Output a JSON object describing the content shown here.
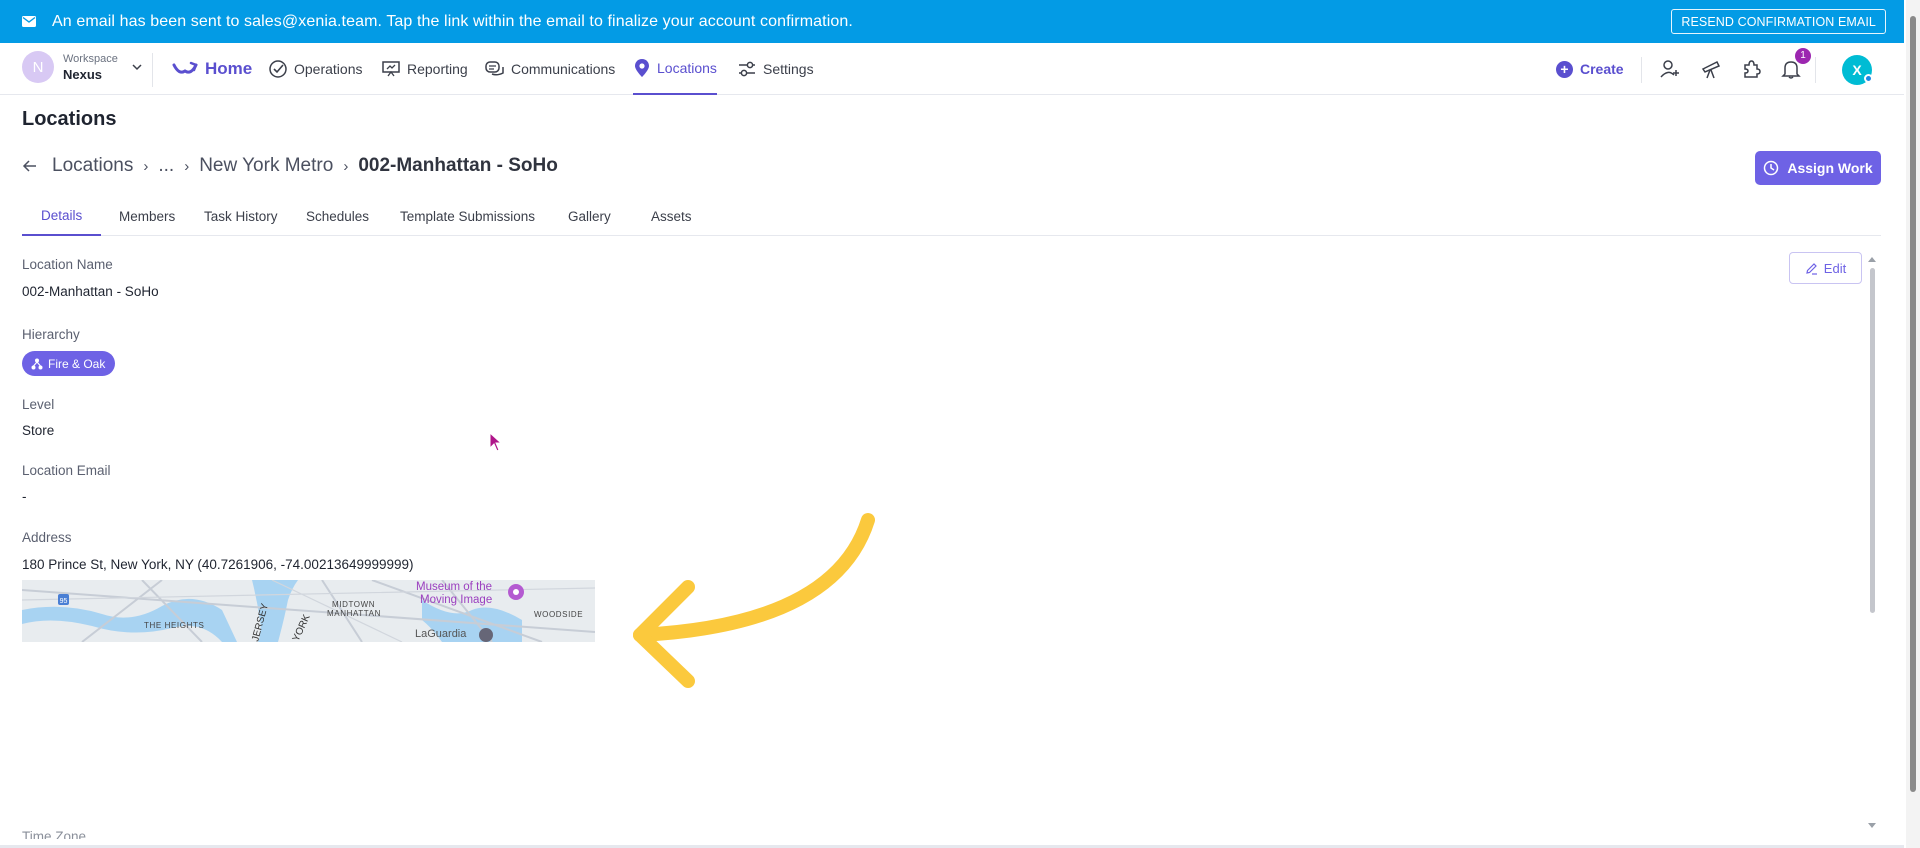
{
  "banner": {
    "message": "An email has been sent to sales@xenia.team. Tap the link within the email to finalize your account confirmation.",
    "resend_label": "RESEND CONFIRMATION EMAIL",
    "color": "#039be5"
  },
  "workspace": {
    "initial": "N",
    "label": "Workspace",
    "name": "Nexus"
  },
  "nav": {
    "home": "Home",
    "items": [
      "Operations",
      "Reporting",
      "Communications",
      "Locations",
      "Settings"
    ],
    "active": "Locations",
    "create": "Create",
    "notification_count": "1",
    "user_initial": "X",
    "accent": "#5a4fcf"
  },
  "page": {
    "title": "Locations",
    "breadcrumb": [
      "Locations",
      "...",
      "New York Metro",
      "002-Manhattan - SoHo"
    ],
    "assign_work": "Assign Work",
    "tabs": [
      "Details",
      "Members",
      "Task History",
      "Schedules",
      "Template Submissions",
      "Gallery",
      "Assets"
    ],
    "active_tab": "Details",
    "edit": "Edit"
  },
  "details": {
    "location_name_label": "Location Name",
    "location_name": "002-Manhattan - SoHo",
    "hierarchy_label": "Hierarchy",
    "hierarchy_chip": "Fire & Oak",
    "level_label": "Level",
    "level": "Store",
    "email_label": "Location Email",
    "email": "-",
    "address_label": "Address",
    "address": "180 Prince St, New York, NY (40.7261906, -74.00213649999999)",
    "next_label_partial": "Time Zone"
  },
  "map": {
    "labels": [
      "Museum of the",
      "Moving Image",
      "MIDTOWN",
      "MANHATTAN",
      "THE HEIGHTS",
      "WOODSIDE",
      "LaGuardia",
      "JERSEY",
      "YORK",
      "95"
    ]
  },
  "annotation": {
    "arrow_color": "#fbc93d"
  }
}
